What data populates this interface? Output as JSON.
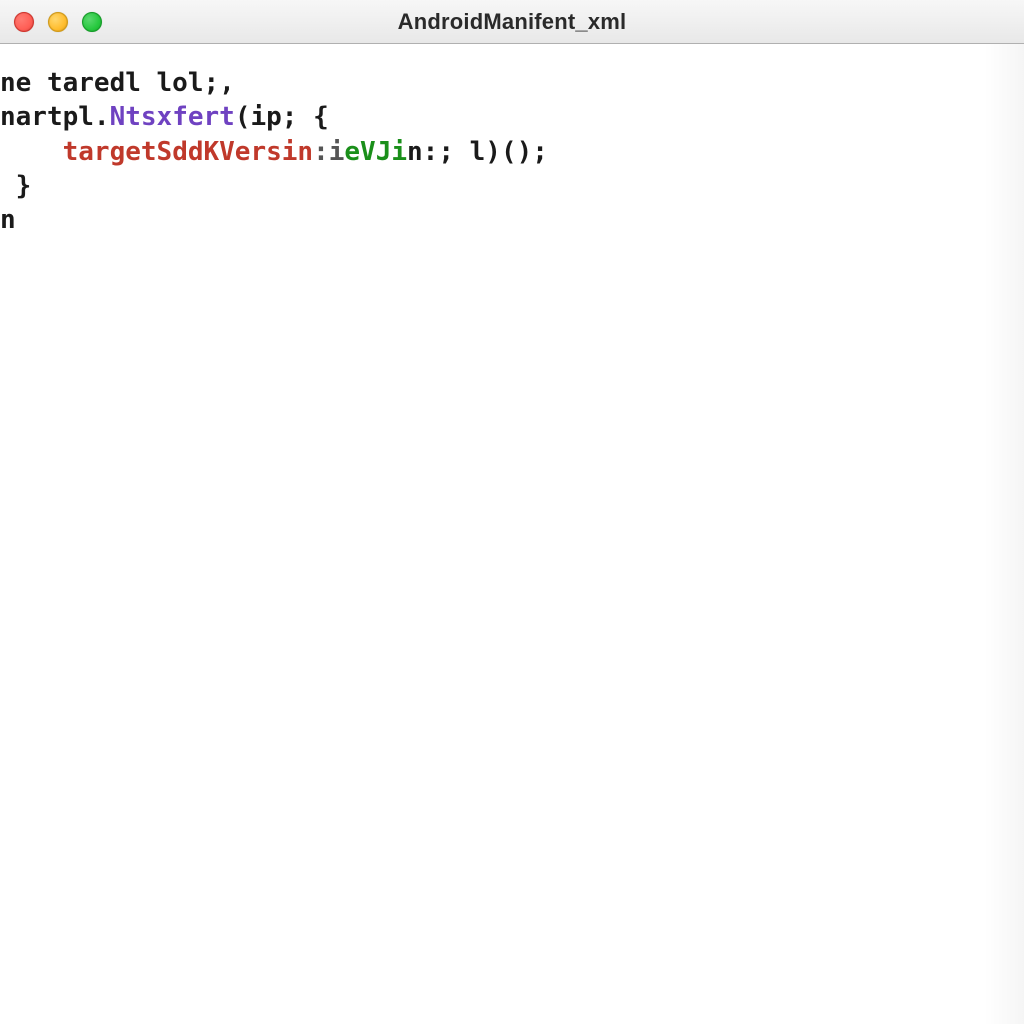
{
  "window": {
    "title": "AndroidManifent_xml"
  },
  "code": {
    "line1": {
      "t1": "ne taredl lol;,"
    },
    "line2": {
      "t1": "nartpl",
      "t2": ".",
      "t3": "Ntsxfert",
      "t4": "(ip; {"
    },
    "line3": {
      "indent": "    ",
      "t1": "targetSddKVersin",
      "t2": ":i",
      "t3": "eVJi",
      "t4": "n:; ",
      "t5": "l",
      "t6": ")();"
    },
    "line4": {
      "t1": " }"
    },
    "line5": {
      "t1": ""
    },
    "line6": {
      "t1": "n"
    }
  }
}
